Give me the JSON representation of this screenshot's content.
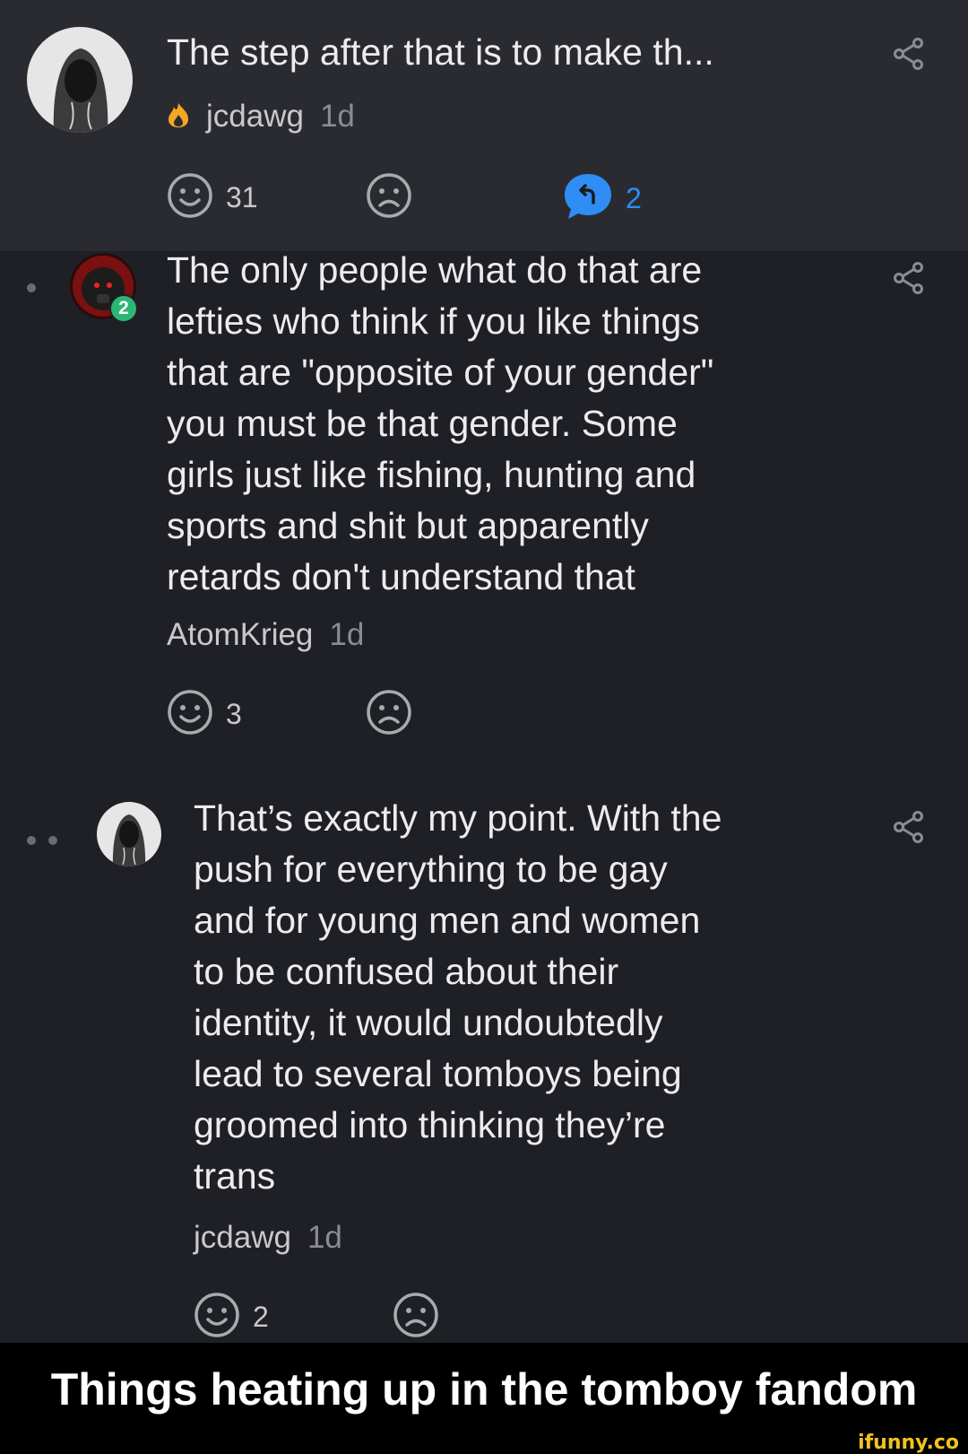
{
  "comments": [
    {
      "text": "The step after that is to make th...",
      "username": "jcdawg",
      "time": "1d",
      "user_flair_icon": "fire-icon",
      "smile_count": "31",
      "reply_count": "2"
    },
    {
      "text": "The only people what do that are\nlefties who think if you like things\nthat are \"opposite of your gender\"\nyou must be that gender. Some\ngirls just like fishing, hunting and\nsports and shit but apparently\nretards don't understand that",
      "username": "AtomKrieg",
      "time": "1d",
      "avatar_badge": "2",
      "smile_count": "3"
    },
    {
      "text": "That’s exactly my point. With the\npush for everything to be gay\nand for young men and women\nto be confused about their\nidentity, it would undoubtedly\nlead to several tomboys being\ngroomed into thinking they’re\ntrans",
      "username": "jcdawg",
      "time": "1d",
      "smile_count": "2"
    }
  ],
  "caption": "Things heating up in the tomboy fandom",
  "watermark": "ifunny.co",
  "colors": {
    "accent_blue": "#2f8df5",
    "badge_green": "#2bb673",
    "flame_orange": "#f5a623"
  }
}
